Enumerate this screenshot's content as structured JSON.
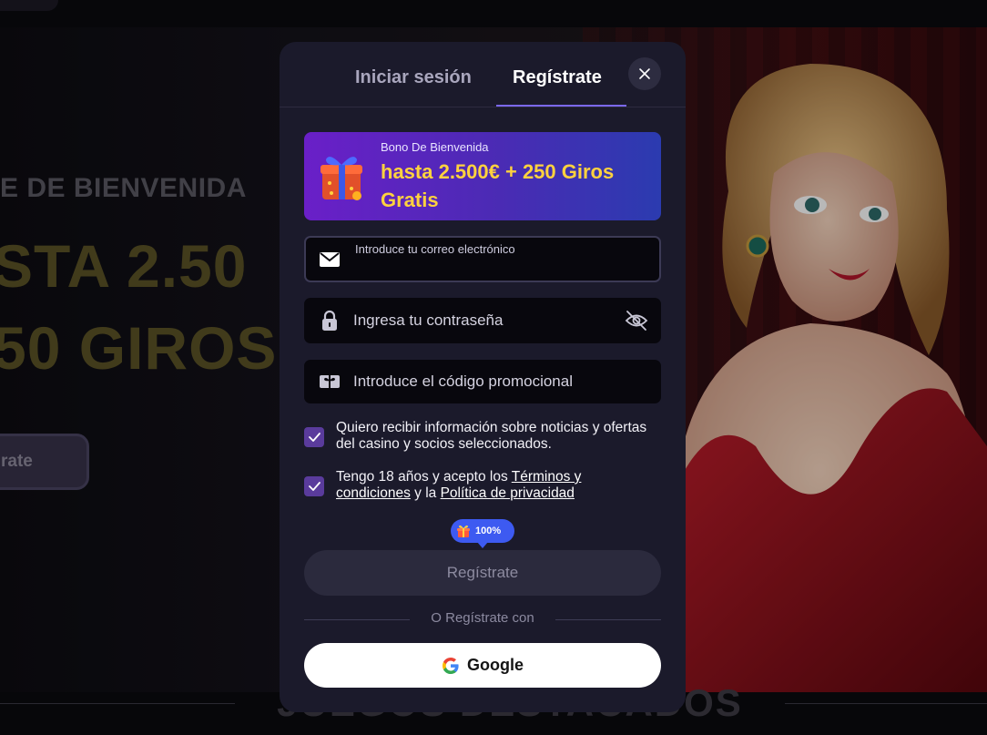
{
  "background": {
    "subtitle": "E DE BIENVENIDA",
    "headline_1": "STA 2.50",
    "headline_2": "50 GIROS",
    "cta": "rate",
    "footer_title": "JUEGOS DESTACADOS"
  },
  "modal": {
    "tabs": {
      "login": "Iniciar sesión",
      "register": "Regístrate"
    },
    "active_tab": "register",
    "bonus": {
      "subtitle": "Bono De Bienvenida",
      "title": "hasta 2.500€ + 250 Giros Gratis"
    },
    "email": {
      "label": "Introduce tu correo electrónico",
      "value": ""
    },
    "password": {
      "placeholder": "Ingresa tu contraseña"
    },
    "promo": {
      "placeholder": "Introduce el código promocional"
    },
    "consent_news": {
      "checked": true,
      "text": "Quiero recibir información sobre noticias y ofertas del casino y socios seleccionados."
    },
    "consent_terms": {
      "checked": true,
      "prefix": "Tengo 18 años y acepto los ",
      "terms_link": "Términos y condiciones",
      "middle": " y la ",
      "privacy_link": "Política de privacidad"
    },
    "progress_badge": "100%",
    "submit_label": "Regístrate",
    "divider": "O Regístrate con",
    "google_label": "Google"
  },
  "colors": {
    "accent": "#7b68ee",
    "bonus_text": "#ffd23e",
    "badge": "#3d5af1",
    "modal_bg": "#1b1a2b"
  }
}
